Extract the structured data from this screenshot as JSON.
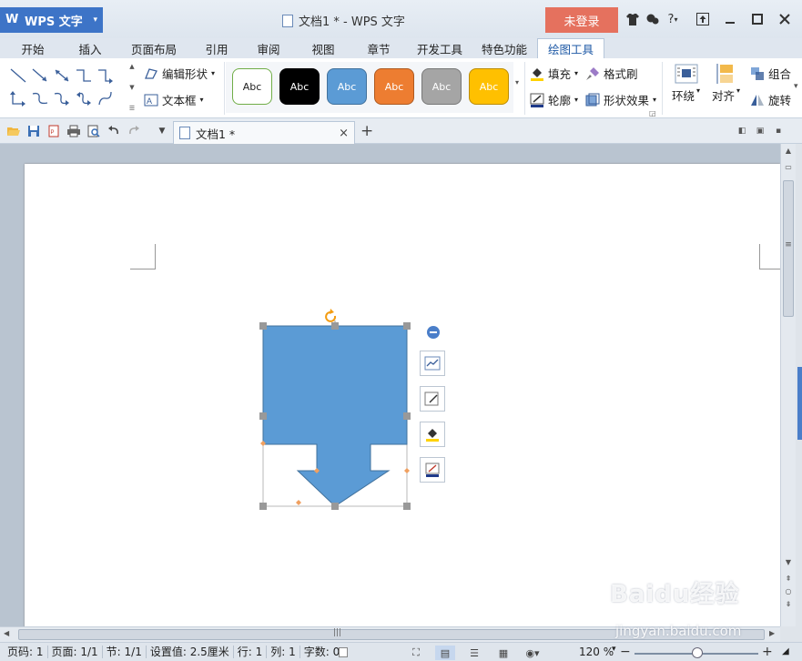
{
  "app": {
    "name": "WPS 文字",
    "caret": "▾"
  },
  "window": {
    "title": "文档1 * - WPS 文字",
    "login_label": "未登录",
    "help_label": "?"
  },
  "menu_tabs": [
    "开始",
    "插入",
    "页面布局",
    "引用",
    "审阅",
    "视图",
    "章节",
    "开发工具",
    "特色功能",
    "绘图工具"
  ],
  "ribbon": {
    "edit_shape_label": "编辑形状",
    "textbox_label": "文本框",
    "style_labels": [
      "Abc",
      "Abc",
      "Abc",
      "Abc",
      "Abc",
      "Abc"
    ],
    "fill_label": "填充",
    "format_painter_label": "格式刷",
    "outline_label": "轮廓",
    "shape_effect_label": "形状效果",
    "wrap_label": "环绕",
    "align_label": "对齐",
    "group_label": "组合",
    "rotate_label": "旋转"
  },
  "doc_tab": {
    "name": "文档1 *",
    "close": "×",
    "add": "+"
  },
  "status": {
    "page": "页码: 1",
    "pages": "页面: 1/1",
    "section": "节: 1/1",
    "setting": "设置值: 2.5厘米",
    "row": "行: 1",
    "col": "列: 1",
    "words": "字数: 0",
    "zoom": "120 %"
  },
  "watermark": {
    "brand": "Baidu经验",
    "url": "jingyan.baidu.com"
  },
  "colors": {
    "shape_fill": "#5b9bd5",
    "app_button": "#3d74c7",
    "login_button": "#e5715e",
    "swatch_white": "#ffffff",
    "swatch_black": "#000000",
    "swatch_blue": "#5b9bd5",
    "swatch_orange": "#ed7d31",
    "swatch_gray": "#a5a5a5",
    "swatch_gold": "#ffc000"
  }
}
